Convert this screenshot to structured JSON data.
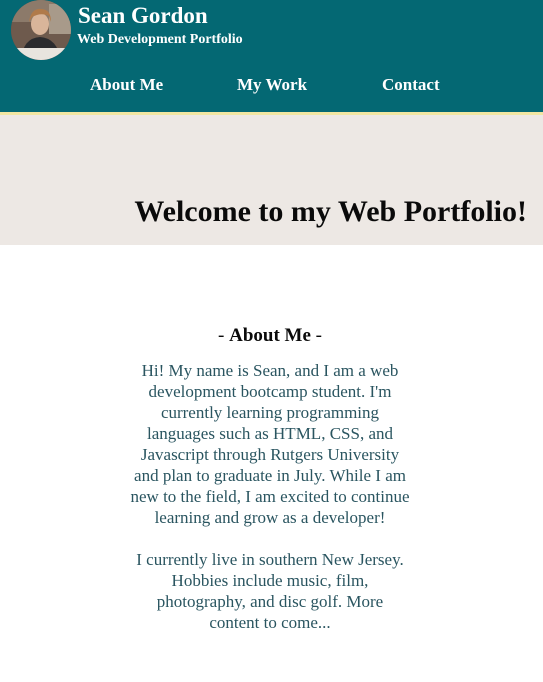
{
  "header": {
    "name": "Sean Gordon",
    "subtitle": "Web Development Portfolio",
    "avatar_icon": "profile-photo",
    "background_color": "#046873",
    "accent_border_color": "#f2e6a2"
  },
  "nav": {
    "items": [
      {
        "label": "About Me"
      },
      {
        "label": "My Work"
      },
      {
        "label": "Contact"
      }
    ]
  },
  "hero": {
    "title": "Welcome to my Web Portfolio!",
    "background_color": "#ede8e4"
  },
  "about": {
    "heading_prefix": "- ",
    "heading": "About Me",
    "heading_suffix": " -",
    "paragraphs": [
      "Hi! My name is Sean, and I am a web development bootcamp student. I'm currently learning programming languages such as HTML, CSS, and Javascript through Rutgers University and plan to graduate in July. While I am new to the field, I am excited to continue learning and grow as a developer!",
      "I currently live in southern New Jersey. Hobbies include music, film, photography, and disc golf. More content to come..."
    ],
    "text_color": "#2a5560"
  }
}
